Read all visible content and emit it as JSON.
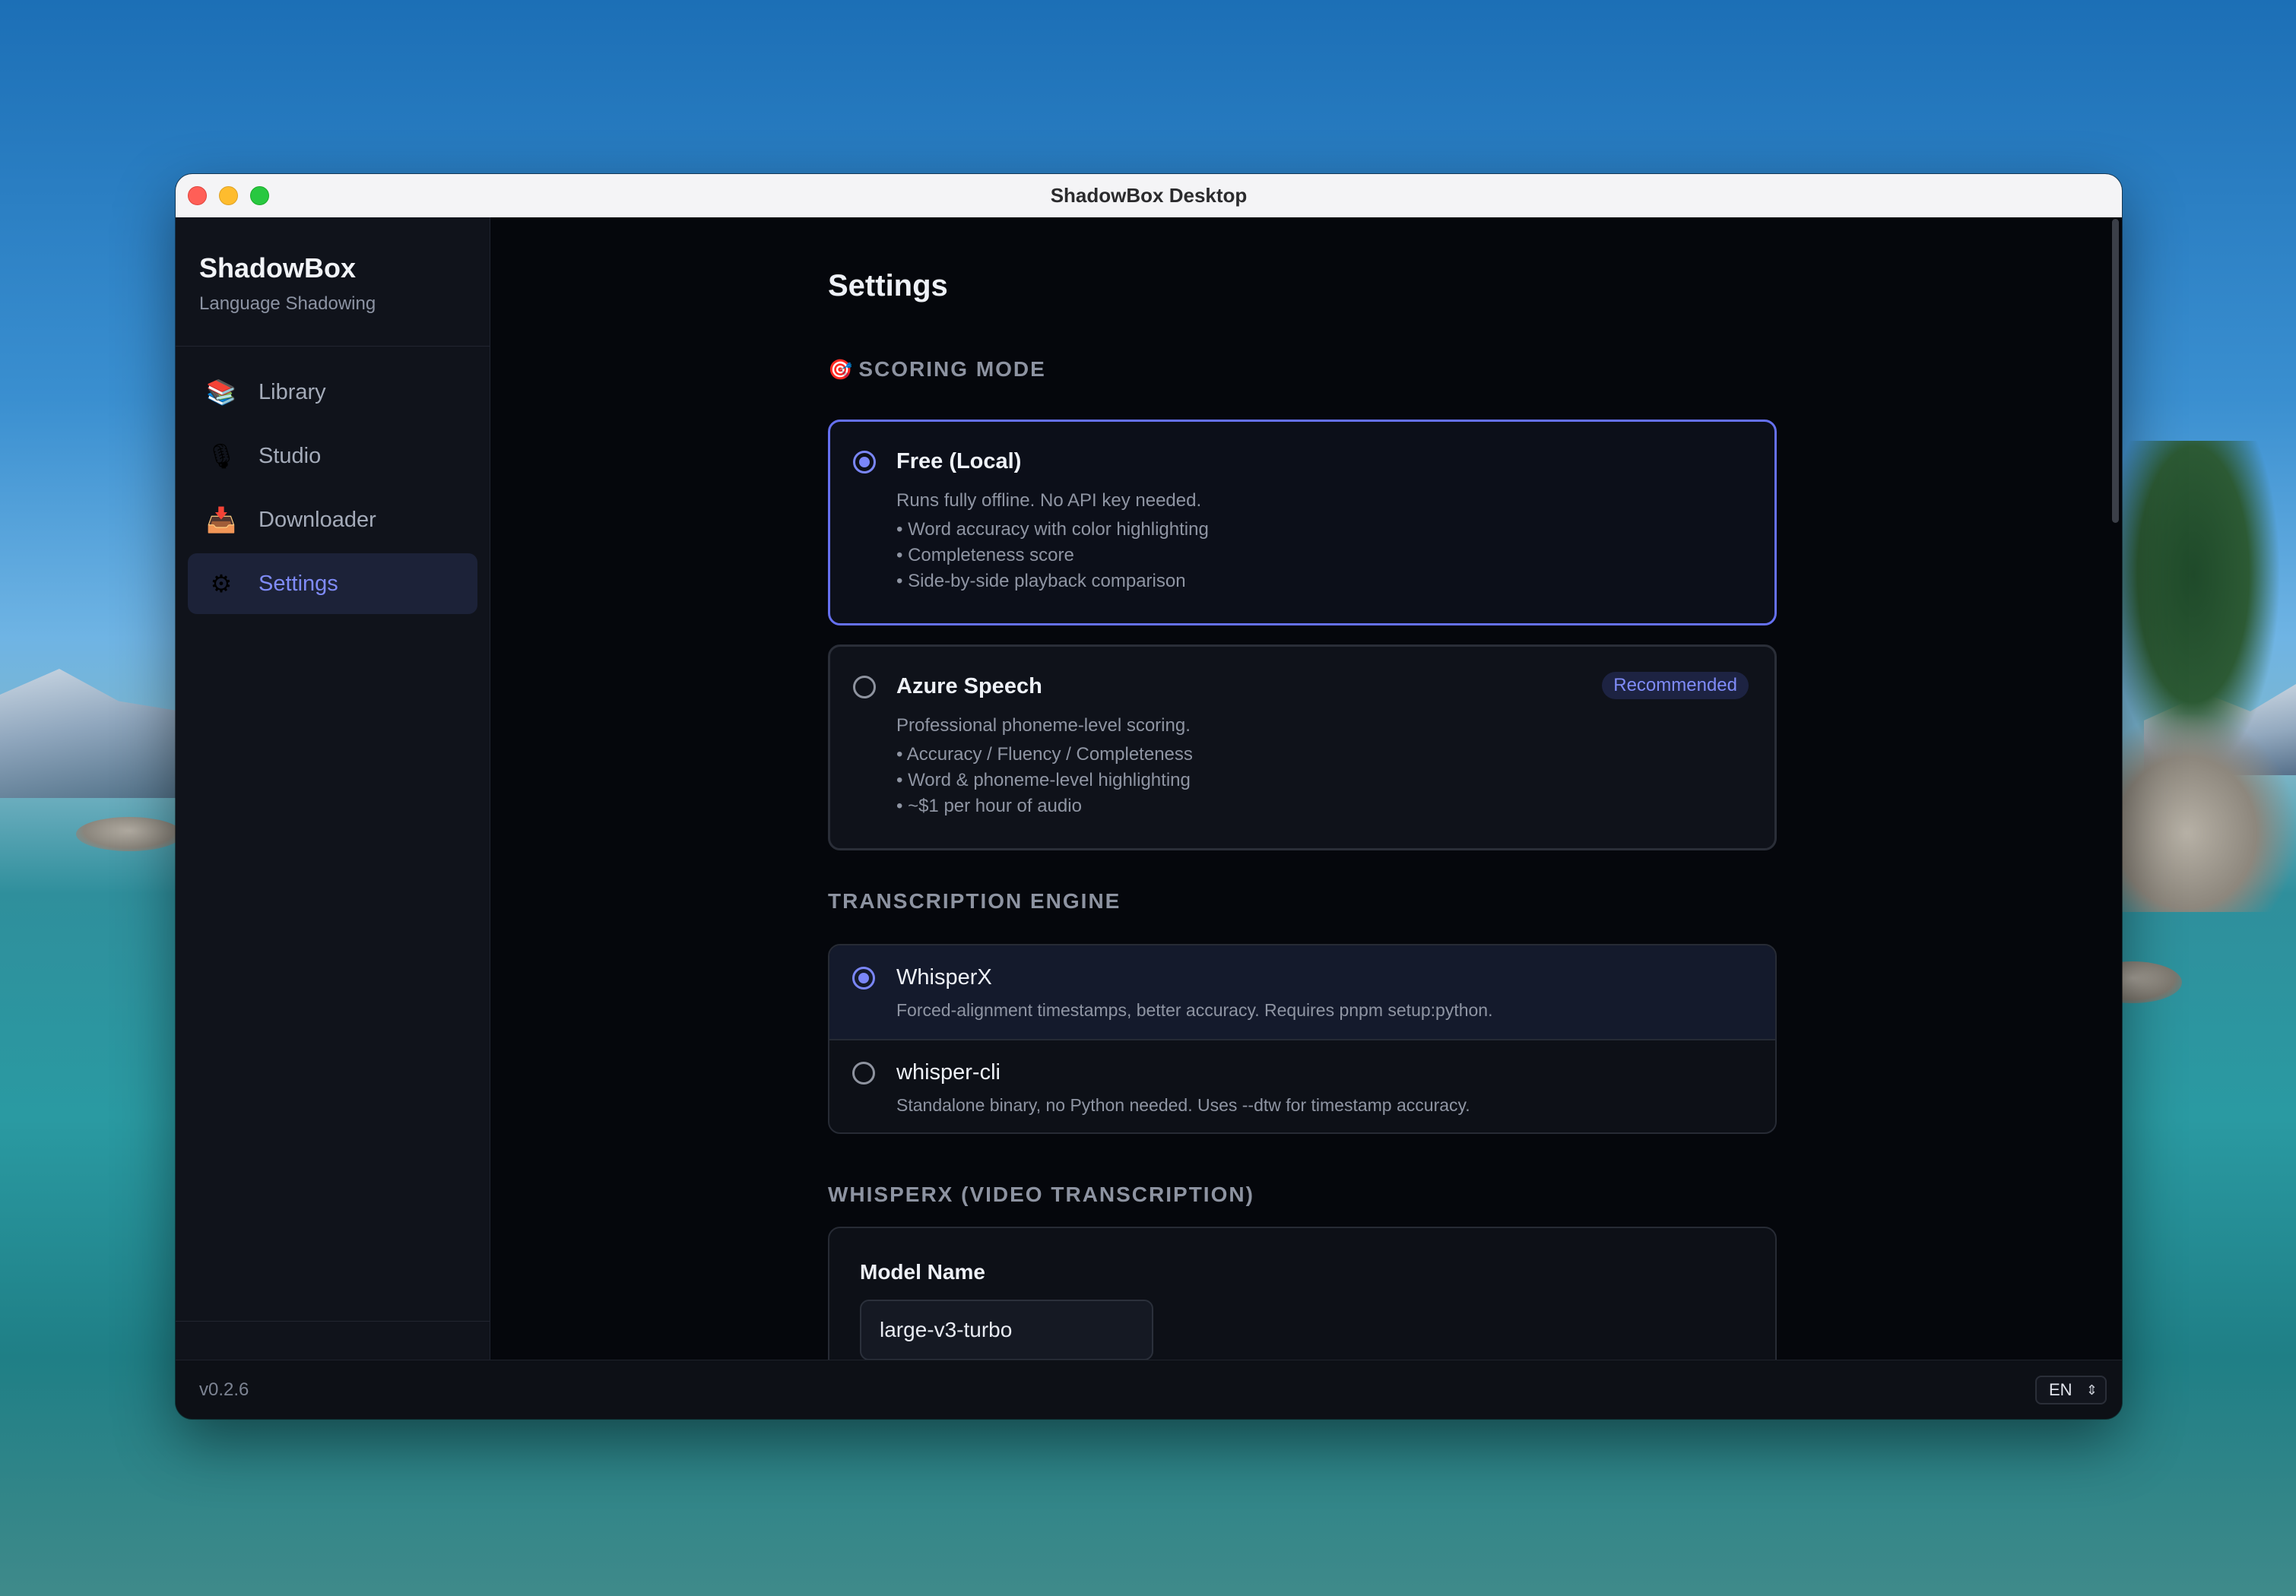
{
  "window": {
    "title": "ShadowBox Desktop"
  },
  "sidebar": {
    "brand": "ShadowBox",
    "subtitle": "Language Shadowing",
    "items": [
      {
        "label": "Library",
        "icon": "📚",
        "icon_name": "books-icon",
        "active": false
      },
      {
        "label": "Studio",
        "icon": "🎙",
        "icon_name": "microphone-icon",
        "active": false
      },
      {
        "label": "Downloader",
        "icon": "📥",
        "icon_name": "inbox-tray-icon",
        "active": false
      },
      {
        "label": "Settings",
        "icon": "⚙",
        "icon_name": "gear-icon",
        "active": true
      }
    ]
  },
  "settings": {
    "title": "Settings",
    "scoring": {
      "heading": "SCORING MODE",
      "heading_icon": "🎯",
      "options": [
        {
          "title": "Free (Local)",
          "description": "Runs fully offline. No API key needed.",
          "bullets": [
            "• Word accuracy with color highlighting",
            "• Completeness score",
            "• Side-by-side playback comparison"
          ],
          "selected": true
        },
        {
          "title": "Azure Speech",
          "badge": "Recommended",
          "description": "Professional phoneme-level scoring.",
          "bullets": [
            "• Accuracy / Fluency / Completeness",
            "• Word & phoneme-level highlighting",
            "• ~$1 per hour of audio"
          ],
          "selected": false
        }
      ]
    },
    "engine": {
      "heading": "TRANSCRIPTION ENGINE",
      "options": [
        {
          "title": "WhisperX",
          "description": "Forced-alignment timestamps, better accuracy. Requires pnpm setup:python.",
          "selected": true
        },
        {
          "title": "whisper-cli",
          "description": "Standalone binary, no Python needed. Uses --dtw for timestamp accuracy.",
          "selected": false
        }
      ]
    },
    "whisperx": {
      "heading": "WHISPERX (VIDEO TRANSCRIPTION)",
      "model_label": "Model Name",
      "model_value": "large-v3-turbo"
    }
  },
  "footer": {
    "version": "v0.2.6",
    "language": "EN"
  },
  "colors": {
    "accent": "#7a86f8",
    "background": "#05070c",
    "sidebar": "#10131b"
  }
}
